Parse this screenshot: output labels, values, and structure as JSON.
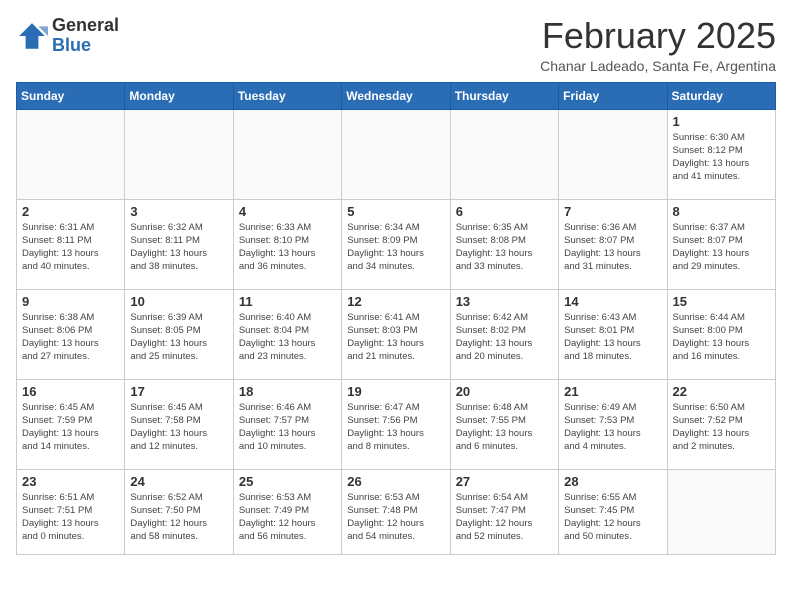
{
  "header": {
    "logo_general": "General",
    "logo_blue": "Blue",
    "month_title": "February 2025",
    "location": "Chanar Ladeado, Santa Fe, Argentina"
  },
  "days_of_week": [
    "Sunday",
    "Monday",
    "Tuesday",
    "Wednesday",
    "Thursday",
    "Friday",
    "Saturday"
  ],
  "weeks": [
    [
      {
        "day": "",
        "info": ""
      },
      {
        "day": "",
        "info": ""
      },
      {
        "day": "",
        "info": ""
      },
      {
        "day": "",
        "info": ""
      },
      {
        "day": "",
        "info": ""
      },
      {
        "day": "",
        "info": ""
      },
      {
        "day": "1",
        "info": "Sunrise: 6:30 AM\nSunset: 8:12 PM\nDaylight: 13 hours\nand 41 minutes."
      }
    ],
    [
      {
        "day": "2",
        "info": "Sunrise: 6:31 AM\nSunset: 8:11 PM\nDaylight: 13 hours\nand 40 minutes."
      },
      {
        "day": "3",
        "info": "Sunrise: 6:32 AM\nSunset: 8:11 PM\nDaylight: 13 hours\nand 38 minutes."
      },
      {
        "day": "4",
        "info": "Sunrise: 6:33 AM\nSunset: 8:10 PM\nDaylight: 13 hours\nand 36 minutes."
      },
      {
        "day": "5",
        "info": "Sunrise: 6:34 AM\nSunset: 8:09 PM\nDaylight: 13 hours\nand 34 minutes."
      },
      {
        "day": "6",
        "info": "Sunrise: 6:35 AM\nSunset: 8:08 PM\nDaylight: 13 hours\nand 33 minutes."
      },
      {
        "day": "7",
        "info": "Sunrise: 6:36 AM\nSunset: 8:07 PM\nDaylight: 13 hours\nand 31 minutes."
      },
      {
        "day": "8",
        "info": "Sunrise: 6:37 AM\nSunset: 8:07 PM\nDaylight: 13 hours\nand 29 minutes."
      }
    ],
    [
      {
        "day": "9",
        "info": "Sunrise: 6:38 AM\nSunset: 8:06 PM\nDaylight: 13 hours\nand 27 minutes."
      },
      {
        "day": "10",
        "info": "Sunrise: 6:39 AM\nSunset: 8:05 PM\nDaylight: 13 hours\nand 25 minutes."
      },
      {
        "day": "11",
        "info": "Sunrise: 6:40 AM\nSunset: 8:04 PM\nDaylight: 13 hours\nand 23 minutes."
      },
      {
        "day": "12",
        "info": "Sunrise: 6:41 AM\nSunset: 8:03 PM\nDaylight: 13 hours\nand 21 minutes."
      },
      {
        "day": "13",
        "info": "Sunrise: 6:42 AM\nSunset: 8:02 PM\nDaylight: 13 hours\nand 20 minutes."
      },
      {
        "day": "14",
        "info": "Sunrise: 6:43 AM\nSunset: 8:01 PM\nDaylight: 13 hours\nand 18 minutes."
      },
      {
        "day": "15",
        "info": "Sunrise: 6:44 AM\nSunset: 8:00 PM\nDaylight: 13 hours\nand 16 minutes."
      }
    ],
    [
      {
        "day": "16",
        "info": "Sunrise: 6:45 AM\nSunset: 7:59 PM\nDaylight: 13 hours\nand 14 minutes."
      },
      {
        "day": "17",
        "info": "Sunrise: 6:45 AM\nSunset: 7:58 PM\nDaylight: 13 hours\nand 12 minutes."
      },
      {
        "day": "18",
        "info": "Sunrise: 6:46 AM\nSunset: 7:57 PM\nDaylight: 13 hours\nand 10 minutes."
      },
      {
        "day": "19",
        "info": "Sunrise: 6:47 AM\nSunset: 7:56 PM\nDaylight: 13 hours\nand 8 minutes."
      },
      {
        "day": "20",
        "info": "Sunrise: 6:48 AM\nSunset: 7:55 PM\nDaylight: 13 hours\nand 6 minutes."
      },
      {
        "day": "21",
        "info": "Sunrise: 6:49 AM\nSunset: 7:53 PM\nDaylight: 13 hours\nand 4 minutes."
      },
      {
        "day": "22",
        "info": "Sunrise: 6:50 AM\nSunset: 7:52 PM\nDaylight: 13 hours\nand 2 minutes."
      }
    ],
    [
      {
        "day": "23",
        "info": "Sunrise: 6:51 AM\nSunset: 7:51 PM\nDaylight: 13 hours\nand 0 minutes."
      },
      {
        "day": "24",
        "info": "Sunrise: 6:52 AM\nSunset: 7:50 PM\nDaylight: 12 hours\nand 58 minutes."
      },
      {
        "day": "25",
        "info": "Sunrise: 6:53 AM\nSunset: 7:49 PM\nDaylight: 12 hours\nand 56 minutes."
      },
      {
        "day": "26",
        "info": "Sunrise: 6:53 AM\nSunset: 7:48 PM\nDaylight: 12 hours\nand 54 minutes."
      },
      {
        "day": "27",
        "info": "Sunrise: 6:54 AM\nSunset: 7:47 PM\nDaylight: 12 hours\nand 52 minutes."
      },
      {
        "day": "28",
        "info": "Sunrise: 6:55 AM\nSunset: 7:45 PM\nDaylight: 12 hours\nand 50 minutes."
      },
      {
        "day": "",
        "info": ""
      }
    ]
  ]
}
